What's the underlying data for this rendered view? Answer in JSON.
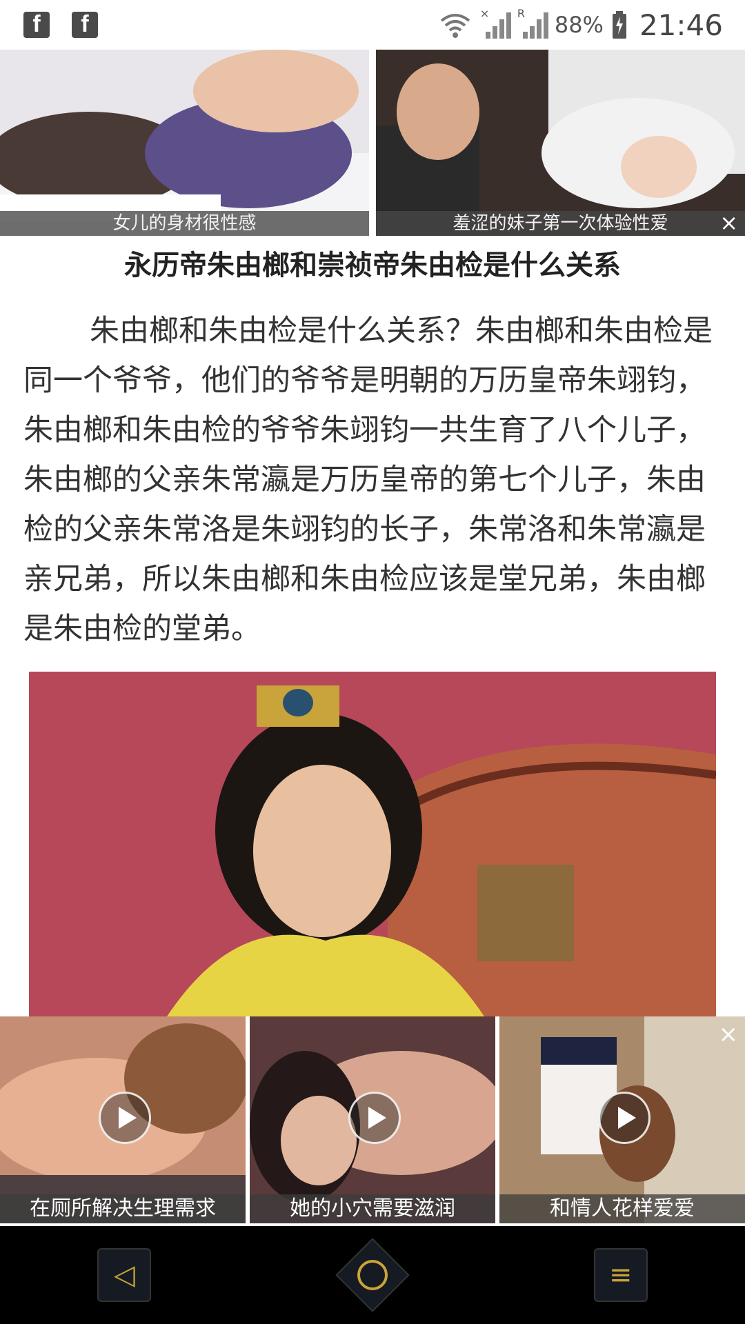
{
  "status_bar": {
    "left_icons": [
      "facebook-icon",
      "facebook-icon"
    ],
    "battery_percent": "88%",
    "time": "21:46",
    "signal_marks": [
      "×",
      "R"
    ]
  },
  "top_ads": [
    {
      "caption": "女儿的身材很性感"
    },
    {
      "caption": "羞涩的妹子第一次体验性爱",
      "close": "×"
    }
  ],
  "article": {
    "title": "永历帝朱由榔和崇祯帝朱由检是什么关系",
    "paragraph": "朱由榔和朱由检是什么关系？朱由榔和朱由检是同一个爷爷，他们的爷爷是明朝的万历皇帝朱翊钧，朱由榔和朱由检的爷爷朱翊钧一共生育了八个儿子，朱由榔的父亲朱常瀛是万历皇帝的第七个儿子，朱由检的父亲朱常洛是朱翊钧的长子，朱常洛和朱常瀛是亲兄弟，所以朱由榔和朱由检应该是堂兄弟，朱由榔是朱由检的堂弟。"
  },
  "bottom_ads": {
    "close": "×",
    "items": [
      {
        "caption": "在厕所解决生理需求"
      },
      {
        "caption": "她的小穴需要滋润"
      },
      {
        "caption": "和情人花样爱爱"
      }
    ]
  },
  "nav_bar": {
    "back_glyph": "◁",
    "menu_glyph": "≡"
  },
  "colors": {
    "nav_accent": "#c9a43a",
    "nav_background": "#000000"
  }
}
